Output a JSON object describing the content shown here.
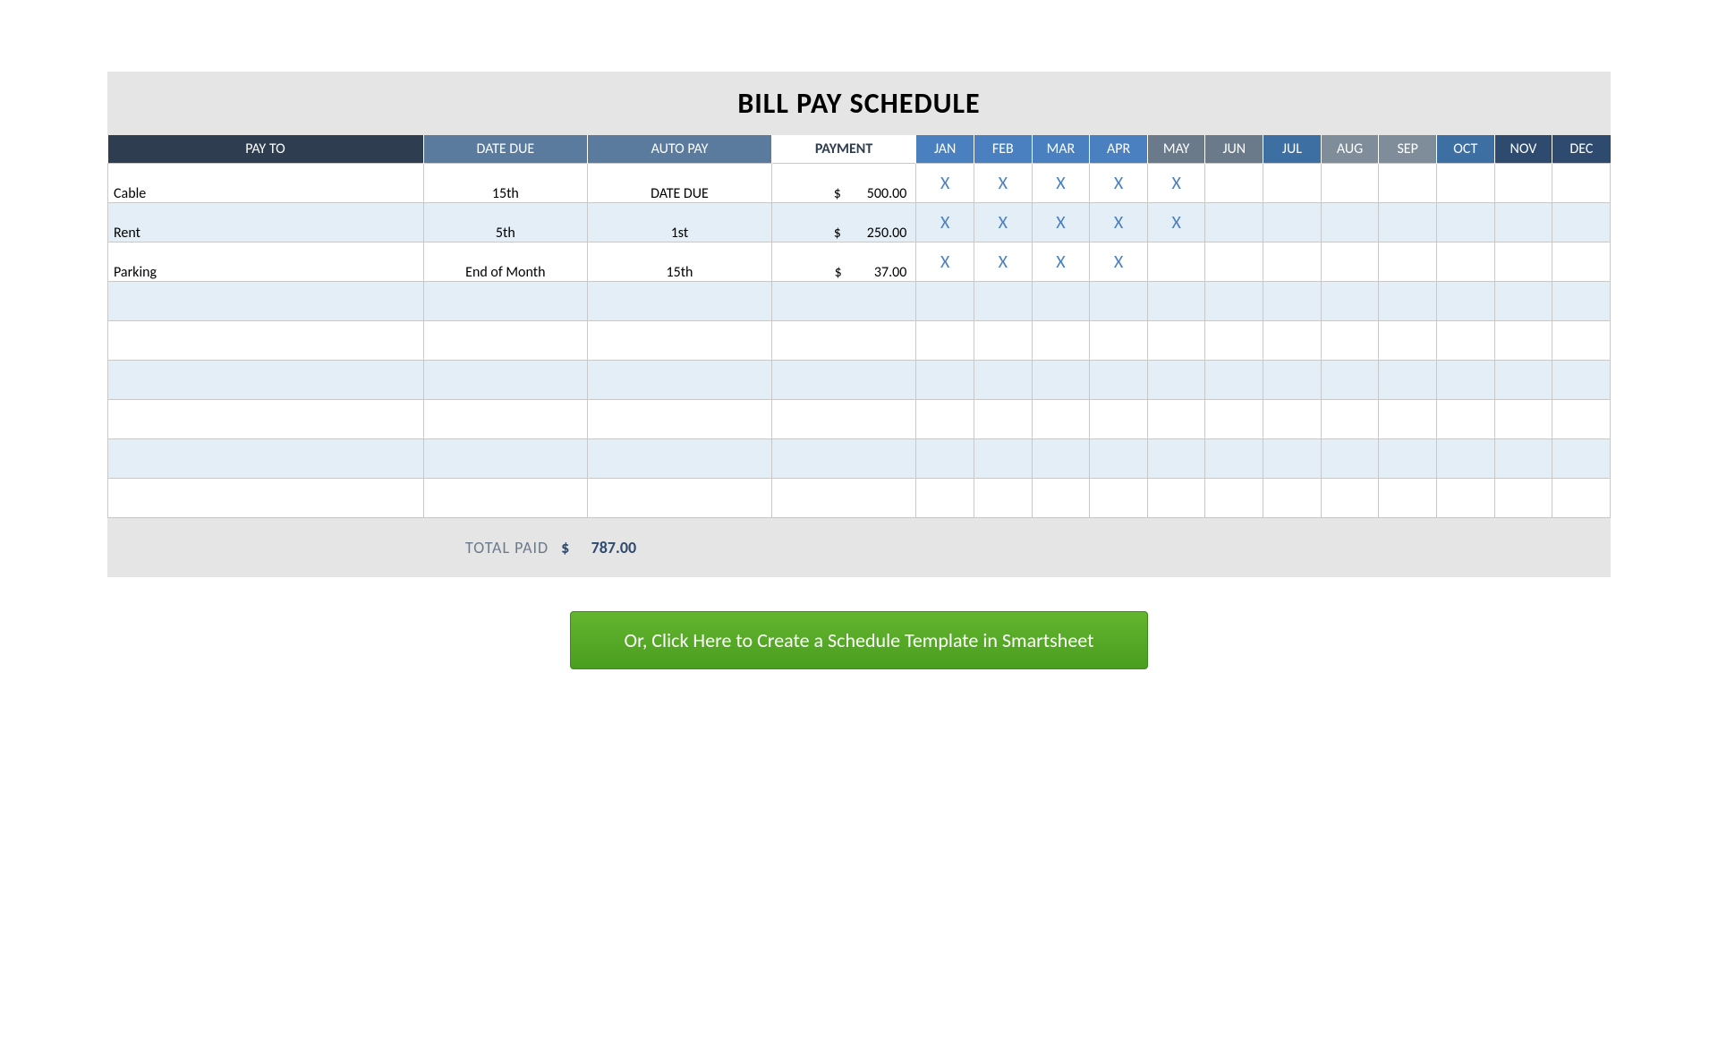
{
  "title": "BILL PAY SCHEDULE",
  "headers": {
    "payto": "PAY TO",
    "datedue": "DATE DUE",
    "autopay": "AUTO PAY",
    "payment": "PAYMENT"
  },
  "months": [
    "JAN",
    "FEB",
    "MAR",
    "APR",
    "MAY",
    "JUN",
    "JUL",
    "AUG",
    "SEP",
    "OCT",
    "NOV",
    "DEC"
  ],
  "month_header_styles": [
    "blue1",
    "blue1",
    "blue1",
    "blue1",
    "slate",
    "slate",
    "steel",
    "grey",
    "grey",
    "steel",
    "navy",
    "navy"
  ],
  "mark_symbol": "X",
  "rows": [
    {
      "payto": "Cable",
      "datedue": "15th",
      "autopay": "DATE DUE",
      "payment_display": "$        500.00",
      "marks": [
        true,
        true,
        true,
        true,
        true,
        false,
        false,
        false,
        false,
        false,
        false,
        false
      ]
    },
    {
      "payto": "Rent",
      "datedue": "5th",
      "autopay": "1st",
      "payment_display": "$        250.00",
      "marks": [
        true,
        true,
        true,
        true,
        true,
        false,
        false,
        false,
        false,
        false,
        false,
        false
      ]
    },
    {
      "payto": "Parking",
      "datedue": "End of Month",
      "autopay": "15th",
      "payment_display": "$          37.00",
      "marks": [
        true,
        true,
        true,
        true,
        false,
        false,
        false,
        false,
        false,
        false,
        false,
        false
      ]
    },
    {
      "payto": "",
      "datedue": "",
      "autopay": "",
      "payment_display": "",
      "marks": [
        false,
        false,
        false,
        false,
        false,
        false,
        false,
        false,
        false,
        false,
        false,
        false
      ]
    },
    {
      "payto": "",
      "datedue": "",
      "autopay": "",
      "payment_display": "",
      "marks": [
        false,
        false,
        false,
        false,
        false,
        false,
        false,
        false,
        false,
        false,
        false,
        false
      ]
    },
    {
      "payto": "",
      "datedue": "",
      "autopay": "",
      "payment_display": "",
      "marks": [
        false,
        false,
        false,
        false,
        false,
        false,
        false,
        false,
        false,
        false,
        false,
        false
      ]
    },
    {
      "payto": "",
      "datedue": "",
      "autopay": "",
      "payment_display": "",
      "marks": [
        false,
        false,
        false,
        false,
        false,
        false,
        false,
        false,
        false,
        false,
        false,
        false
      ]
    },
    {
      "payto": "",
      "datedue": "",
      "autopay": "",
      "payment_display": "",
      "marks": [
        false,
        false,
        false,
        false,
        false,
        false,
        false,
        false,
        false,
        false,
        false,
        false
      ]
    },
    {
      "payto": "",
      "datedue": "",
      "autopay": "",
      "payment_display": "",
      "marks": [
        false,
        false,
        false,
        false,
        false,
        false,
        false,
        false,
        false,
        false,
        false,
        false
      ]
    }
  ],
  "total": {
    "label": "TOTAL PAID",
    "value_display": "$      787.00"
  },
  "cta_label": "Or, Click Here to Create a Schedule Template in Smartsheet"
}
